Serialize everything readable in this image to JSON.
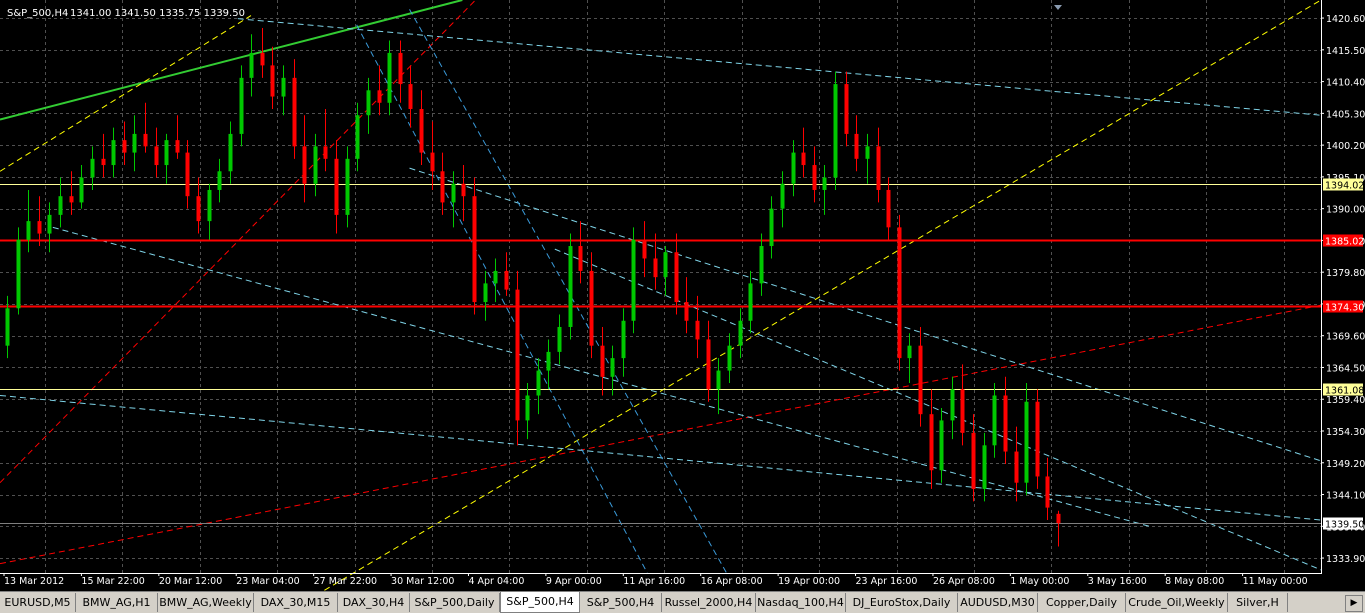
{
  "window": {
    "title_symbol": "S&P_500,H4",
    "ohlc": "1341.00 1341.50 1335.75 1339.50"
  },
  "colors": {
    "background": "#000000",
    "grid": "#505050",
    "axis_text": "#ffffff",
    "bull": "#00c800",
    "bear": "#ff0000",
    "red_line": "#ff0000",
    "yellow_line": "#ffff00",
    "green_line": "#33cc33",
    "cyan_line": "#7fd4e8",
    "blue_line": "#3a9ad9",
    "ask_line": "#7f7f7f"
  },
  "chart_data": {
    "type": "candlestick",
    "symbol": "S&P_500",
    "timeframe": "H4",
    "ylim": [
      1331.5,
      1423.5
    ],
    "y_ticks": [
      "1420.60",
      "1415.50",
      "1410.40",
      "1405.30",
      "1400.20",
      "1395.10",
      "1390.00",
      "1384.90",
      "1379.80",
      "1374.70",
      "1369.60",
      "1364.50",
      "1359.40",
      "1354.30",
      "1349.20",
      "1344.10",
      "1339.00",
      "1333.90"
    ],
    "x_labels": [
      "13 Mar 2012",
      "15 Mar 22:00",
      "20 Mar 12:00",
      "23 Mar 04:00",
      "27 Mar 22:00",
      "30 Mar 12:00",
      "4 Apr 04:00",
      "9 Apr 00:00",
      "11 Apr 16:00",
      "16 Apr 08:00",
      "19 Apr 00:00",
      "23 Apr 16:00",
      "26 Apr 08:00",
      "1 May 00:00",
      "3 May 16:00",
      "8 May 08:00",
      "11 May 00:00"
    ],
    "grid": true,
    "price_levels": [
      {
        "label": "1394.02",
        "value": 1394.02,
        "color": "#ffff99",
        "style": "horizontal-thin"
      },
      {
        "label": "1385.02",
        "value": 1385.02,
        "color": "#ff0000",
        "style": "horizontal-thick"
      },
      {
        "label": "1374.30",
        "value": 1374.3,
        "color": "#ff0000",
        "style": "horizontal-thick"
      },
      {
        "label": "1361.08",
        "value": 1361.08,
        "color": "#ffff99",
        "style": "horizontal-thin"
      },
      {
        "label": "1339.50",
        "value": 1339.5,
        "color": "#ffffff",
        "style": "current-price"
      }
    ],
    "candles": [
      [
        1368,
        1376,
        1366,
        1374
      ],
      [
        1374,
        1387,
        1373,
        1385
      ],
      [
        1385,
        1393,
        1383,
        1388
      ],
      [
        1388,
        1392,
        1384,
        1386
      ],
      [
        1386,
        1391,
        1383,
        1389
      ],
      [
        1389,
        1395,
        1387,
        1392
      ],
      [
        1392,
        1396,
        1389,
        1391
      ],
      [
        1391,
        1397,
        1390,
        1395
      ],
      [
        1395,
        1400,
        1393,
        1398
      ],
      [
        1398,
        1402,
        1395,
        1397
      ],
      [
        1397,
        1403,
        1395,
        1401
      ],
      [
        1401,
        1404,
        1397,
        1399
      ],
      [
        1399,
        1405,
        1396,
        1402
      ],
      [
        1402,
        1407,
        1399,
        1400
      ],
      [
        1400,
        1403,
        1395,
        1397
      ],
      [
        1397,
        1402,
        1394,
        1401
      ],
      [
        1401,
        1405,
        1398,
        1399
      ],
      [
        1399,
        1401,
        1390,
        1392
      ],
      [
        1392,
        1395,
        1386,
        1388
      ],
      [
        1388,
        1394,
        1385,
        1393
      ],
      [
        1393,
        1398,
        1391,
        1396
      ],
      [
        1396,
        1404,
        1394,
        1402
      ],
      [
        1402,
        1413,
        1400,
        1411
      ],
      [
        1411,
        1418,
        1408,
        1415
      ],
      [
        1415,
        1419,
        1411,
        1413
      ],
      [
        1413,
        1416,
        1406,
        1408
      ],
      [
        1408,
        1413,
        1405,
        1411
      ],
      [
        1411,
        1414,
        1398,
        1400
      ],
      [
        1400,
        1405,
        1391,
        1394
      ],
      [
        1394,
        1402,
        1392,
        1400
      ],
      [
        1400,
        1406,
        1396,
        1398
      ],
      [
        1398,
        1401,
        1386,
        1389
      ],
      [
        1389,
        1400,
        1387,
        1398
      ],
      [
        1398,
        1407,
        1396,
        1405
      ],
      [
        1405,
        1411,
        1402,
        1409
      ],
      [
        1409,
        1413,
        1405,
        1407
      ],
      [
        1407,
        1417,
        1405,
        1415
      ],
      [
        1415,
        1417,
        1407,
        1410
      ],
      [
        1410,
        1413,
        1403,
        1406
      ],
      [
        1406,
        1409,
        1397,
        1399
      ],
      [
        1399,
        1404,
        1393,
        1396
      ],
      [
        1396,
        1399,
        1389,
        1391
      ],
      [
        1391,
        1396,
        1387,
        1394
      ],
      [
        1394,
        1397,
        1388,
        1392
      ],
      [
        1392,
        1395,
        1373,
        1375
      ],
      [
        1375,
        1380,
        1372,
        1378
      ],
      [
        1378,
        1382,
        1375,
        1380
      ],
      [
        1380,
        1383,
        1376,
        1377
      ],
      [
        1377,
        1380,
        1352,
        1356
      ],
      [
        1356,
        1362,
        1353,
        1360
      ],
      [
        1360,
        1366,
        1357,
        1364
      ],
      [
        1364,
        1369,
        1361,
        1367
      ],
      [
        1367,
        1373,
        1365,
        1371
      ],
      [
        1371,
        1386,
        1369,
        1384
      ],
      [
        1384,
        1388,
        1378,
        1380
      ],
      [
        1380,
        1383,
        1366,
        1368
      ],
      [
        1368,
        1371,
        1360,
        1363
      ],
      [
        1363,
        1368,
        1360,
        1366
      ],
      [
        1366,
        1374,
        1363,
        1372
      ],
      [
        1372,
        1387,
        1370,
        1385
      ],
      [
        1385,
        1388,
        1379,
        1382
      ],
      [
        1382,
        1386,
        1377,
        1379
      ],
      [
        1379,
        1384,
        1376,
        1383
      ],
      [
        1383,
        1386,
        1373,
        1375
      ],
      [
        1375,
        1379,
        1370,
        1372
      ],
      [
        1372,
        1376,
        1366,
        1369
      ],
      [
        1369,
        1372,
        1359,
        1361
      ],
      [
        1361,
        1366,
        1357,
        1364
      ],
      [
        1364,
        1370,
        1362,
        1368
      ],
      [
        1368,
        1374,
        1366,
        1372
      ],
      [
        1372,
        1380,
        1370,
        1378
      ],
      [
        1378,
        1386,
        1376,
        1384
      ],
      [
        1384,
        1392,
        1382,
        1390
      ],
      [
        1390,
        1396,
        1387,
        1394
      ],
      [
        1394,
        1401,
        1392,
        1399
      ],
      [
        1399,
        1403,
        1395,
        1397
      ],
      [
        1397,
        1400,
        1391,
        1393
      ],
      [
        1393,
        1397,
        1389,
        1395
      ],
      [
        1395,
        1412,
        1393,
        1410
      ],
      [
        1410,
        1412,
        1400,
        1402
      ],
      [
        1402,
        1405,
        1396,
        1398
      ],
      [
        1398,
        1402,
        1394,
        1400
      ],
      [
        1400,
        1403,
        1391,
        1393
      ],
      [
        1393,
        1395,
        1385,
        1387
      ],
      [
        1387,
        1389,
        1364,
        1366
      ],
      [
        1366,
        1370,
        1362,
        1368
      ],
      [
        1368,
        1371,
        1355,
        1357
      ],
      [
        1357,
        1361,
        1345,
        1348
      ],
      [
        1348,
        1358,
        1346,
        1356
      ],
      [
        1356,
        1363,
        1353,
        1361
      ],
      [
        1361,
        1365,
        1352,
        1354
      ],
      [
        1354,
        1357,
        1343,
        1345
      ],
      [
        1345,
        1354,
        1343,
        1352
      ],
      [
        1352,
        1362,
        1350,
        1360
      ],
      [
        1360,
        1363,
        1349,
        1351
      ],
      [
        1351,
        1355,
        1343,
        1346
      ],
      [
        1346,
        1362,
        1344,
        1359
      ],
      [
        1359,
        1361,
        1345,
        1347
      ],
      [
        1347,
        1350,
        1340,
        1342
      ],
      [
        1341,
        1341.5,
        1335.75,
        1339.5
      ]
    ],
    "trendlines": [
      {
        "color": "green",
        "style": "solid",
        "x1": 0.0,
        "y1": 1404.3,
        "x2": 0.35,
        "y2": 1423.5
      },
      {
        "color": "yellow",
        "style": "dashed",
        "x1": 0.0,
        "y1": 1396.0,
        "x2": 0.19,
        "y2": 1421.0
      },
      {
        "color": "yellow",
        "style": "dashed",
        "x1": 0.2,
        "y1": 1323.0,
        "x2": 1.0,
        "y2": 1423.5
      },
      {
        "color": "red",
        "style": "dashed",
        "x1": 0.0,
        "y1": 1346.0,
        "x2": 0.36,
        "y2": 1423.5
      },
      {
        "color": "red",
        "style": "dashed",
        "x1": 0.0,
        "y1": 1333.0,
        "x2": 1.0,
        "y2": 1374.5
      },
      {
        "color": "cyan",
        "style": "dashed",
        "x1": 0.18,
        "y1": 1420.5,
        "x2": 1.0,
        "y2": 1405.0
      },
      {
        "color": "cyan",
        "style": "dashed",
        "x1": 0.31,
        "y1": 1396.5,
        "x2": 1.0,
        "y2": 1349.5
      },
      {
        "color": "cyan",
        "style": "dashed",
        "x1": 0.04,
        "y1": 1387.0,
        "x2": 0.87,
        "y2": 1339.0
      },
      {
        "color": "cyan",
        "style": "dashed",
        "x1": 0.0,
        "y1": 1360.0,
        "x2": 1.0,
        "y2": 1340.0
      },
      {
        "color": "cyan",
        "style": "dashed",
        "x1": 0.42,
        "y1": 1383.5,
        "x2": 1.0,
        "y2": 1332.0
      },
      {
        "color": "blue",
        "style": "dashed",
        "x1": 0.27,
        "y1": 1419.5,
        "x2": 0.49,
        "y2": 1331.5
      },
      {
        "color": "blue",
        "style": "dashed",
        "x1": 0.31,
        "y1": 1422.0,
        "x2": 0.55,
        "y2": 1331.5
      }
    ]
  },
  "tabs": [
    {
      "label": "EURUSD,M5",
      "active": false
    },
    {
      "label": "BMW_AG,H1",
      "active": false
    },
    {
      "label": "BMW_AG,Weekly",
      "active": false
    },
    {
      "label": "DAX_30,M15",
      "active": false
    },
    {
      "label": "DAX_30,H4",
      "active": false
    },
    {
      "label": "S&P_500,Daily",
      "active": false
    },
    {
      "label": "S&P_500,H4",
      "active": true
    },
    {
      "label": "S&P_500,H4",
      "active": false
    },
    {
      "label": "Russel_2000,H4",
      "active": false
    },
    {
      "label": "Nasdaq_100,H4",
      "active": false
    },
    {
      "label": "DJ_EuroStox,Daily",
      "active": false
    },
    {
      "label": "AUDUSD,M30",
      "active": false
    },
    {
      "label": "Copper,Daily",
      "active": false
    },
    {
      "label": "Crude_Oil,Weekly",
      "active": false
    },
    {
      "label": "Silver,H",
      "active": false
    }
  ]
}
